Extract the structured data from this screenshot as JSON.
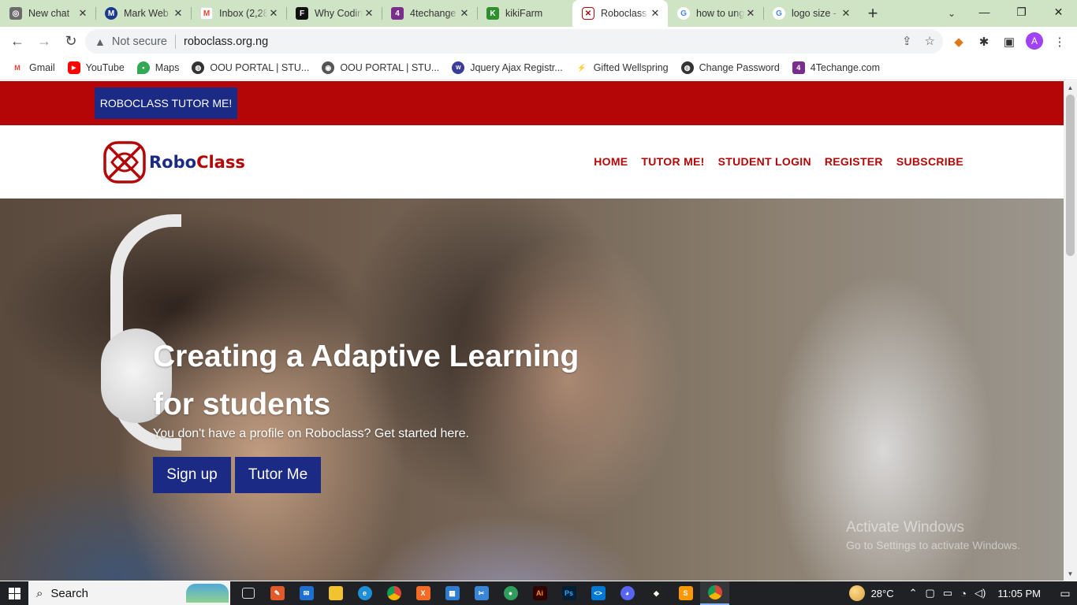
{
  "browser": {
    "tabs": [
      {
        "title": "New chat",
        "icon": "openai-icon",
        "color": "#6b6b6b",
        "glyph": "◎"
      },
      {
        "title": "Mark Web",
        "icon": "mark-icon",
        "color": "#1a3a8c",
        "glyph": "M"
      },
      {
        "title": "Inbox (2,28",
        "icon": "gmail-icon",
        "color": "#ffffff",
        "glyph": "M"
      },
      {
        "title": "Why Codin",
        "icon": "f-icon",
        "color": "#111111",
        "glyph": "F"
      },
      {
        "title": "4techange",
        "icon": "4techange-icon",
        "color": "#7a2e8c",
        "glyph": "4"
      },
      {
        "title": "kikiFarm",
        "icon": "kikifarm-icon",
        "color": "#2f8f2f",
        "glyph": "K"
      },
      {
        "title": "Roboclass",
        "icon": "roboclass-icon",
        "color": "#b40606",
        "glyph": "✕"
      },
      {
        "title": "how to ung",
        "icon": "google-icon",
        "color": "#4285f4",
        "glyph": "G"
      },
      {
        "title": "logo size -",
        "icon": "google-icon",
        "color": "#4285f4",
        "glyph": "G"
      }
    ],
    "active_tab_index": 6,
    "new_tab": "+",
    "address": {
      "warning": "Not secure",
      "url": "roboclass.org.ng"
    },
    "profile_initial": "A",
    "bookmarks": [
      {
        "label": "Gmail",
        "icon": "gmail-icon",
        "color": "#ea4335",
        "glyph": "M"
      },
      {
        "label": "YouTube",
        "icon": "youtube-icon",
        "color": "#ff0000",
        "glyph": "▶"
      },
      {
        "label": "Maps",
        "icon": "maps-icon",
        "color": "#34a853",
        "glyph": "•"
      },
      {
        "label": "OOU PORTAL | STU...",
        "icon": "globe-icon",
        "color": "#333333",
        "glyph": "◍"
      },
      {
        "label": "OOU PORTAL | STU...",
        "icon": "oou-icon",
        "color": "#555555",
        "glyph": "◉"
      },
      {
        "label": "Jquery Ajax Registr...",
        "icon": "web-icon",
        "color": "#3b3b9a",
        "glyph": "W"
      },
      {
        "label": "Gifted Wellspring",
        "icon": "wellspring-icon",
        "color": "#d08a20",
        "glyph": "⚡"
      },
      {
        "label": "Change Password",
        "icon": "globe-icon",
        "color": "#333333",
        "glyph": "◍"
      },
      {
        "label": "4Techange.com",
        "icon": "4techange-icon",
        "color": "#7a2e8c",
        "glyph": "4"
      }
    ]
  },
  "site": {
    "topbar_button": "ROBOCLASS TUTOR ME!",
    "logo": {
      "part1": "Robo",
      "part2": "Class"
    },
    "nav": [
      "HOME",
      "TUTOR ME!",
      "STUDENT LOGIN",
      "REGISTER",
      "SUBSCRIBE"
    ],
    "hero": {
      "title_line1": "Creating a Adaptive Learning",
      "title_line2": "for students",
      "subtitle": "You don't have a profile on Roboclass? Get started here.",
      "signup": "Sign up",
      "tutor": "Tutor Me"
    },
    "colors": {
      "brand_red": "#b40606",
      "brand_blue": "#1b2a84"
    }
  },
  "watermark": {
    "line1": "Activate Windows",
    "line2": "Go to Settings to activate Windows."
  },
  "taskbar": {
    "search_label": "Search",
    "temperature": "28°C",
    "time": "11:05 PM",
    "apps": [
      {
        "name": "task-view-icon",
        "color": "#555555",
        "glyph": "▭"
      },
      {
        "name": "paint-icon",
        "color": "#e05a2a",
        "glyph": "✎"
      },
      {
        "name": "mail-icon",
        "color": "#1f6fd1",
        "glyph": "✉"
      },
      {
        "name": "file-explorer-icon",
        "color": "#f2c230",
        "glyph": "▤"
      },
      {
        "name": "edge-icon",
        "color": "#1e8fd6",
        "glyph": "e"
      },
      {
        "name": "chrome-icon",
        "color": "#db4437",
        "glyph": "◉"
      },
      {
        "name": "xampp-icon",
        "color": "#f46c23",
        "glyph": "X"
      },
      {
        "name": "store-icon",
        "color": "#2d7dd2",
        "glyph": "▦"
      },
      {
        "name": "snip-icon",
        "color": "#3a86d6",
        "glyph": "✂"
      },
      {
        "name": "app-icon",
        "color": "#2e9e5a",
        "glyph": "●"
      },
      {
        "name": "illustrator-icon",
        "color": "#330000",
        "glyph": "Ai"
      },
      {
        "name": "photoshop-icon",
        "color": "#001e36",
        "glyph": "Ps"
      },
      {
        "name": "vscode-icon",
        "color": "#0078d4",
        "glyph": "<>"
      },
      {
        "name": "discord-icon",
        "color": "#5865f2",
        "glyph": "◕"
      },
      {
        "name": "unity-icon",
        "color": "#222222",
        "glyph": "◆"
      },
      {
        "name": "sublime-icon",
        "color": "#ff9800",
        "glyph": "S"
      },
      {
        "name": "chrome-active-icon",
        "color": "#db4437",
        "glyph": "◉"
      }
    ]
  }
}
